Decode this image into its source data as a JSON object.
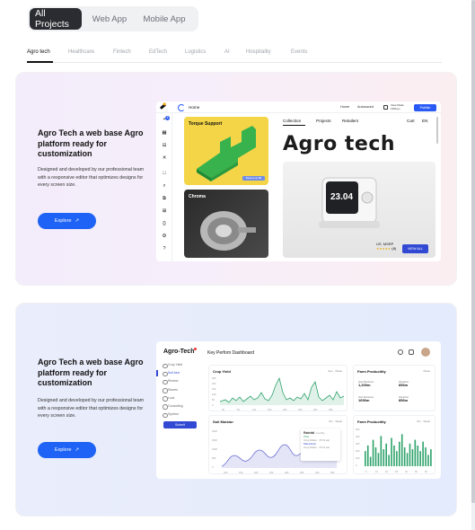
{
  "tabs": [
    "All Projects",
    "Web App",
    "Mobile App"
  ],
  "categories": [
    "Agro tech",
    "Healthcare",
    "Fintech",
    "EdTech",
    "Logistics",
    "AI",
    "Hospitality",
    "Events"
  ],
  "cards": [
    {
      "title": "Agro Tech a web base Agro platform ready for customization",
      "description": "Designed and developed by our professional team with a responsive editor that optimizes designs for every screen size.",
      "button": "Explore",
      "shot": {
        "topbar": {
          "home": "Home",
          "home_link": "Home",
          "autosaved": "Autosaved",
          "view_mode": "View Mode",
          "view_mode_size": "1366 px",
          "publish": "Publish"
        },
        "sidebar_badge": "8",
        "tile1": {
          "label": "Torque Support",
          "cta": "Reserve an RE"
        },
        "tile2": {
          "label": "Chroma"
        },
        "nav": [
          "Collection",
          "Projects",
          "Retailers",
          "Cart",
          "EN"
        ],
        "headline": "Agro tech",
        "device_time": "23.04",
        "msrp": "US. MSRP",
        "rating_count": "(8)",
        "view_all": "VIEW ALL"
      }
    },
    {
      "title": "Agro Tech a web base Agro platform ready for customization",
      "description": "Designed and developed by our professional team with a responsive editor that optimizes designs for every screen size.",
      "button": "Explore",
      "shot": {
        "brand": "Agro-Tech",
        "header_title": "Key Perfom Dashboard",
        "sidebar": [
          "Crop Yield",
          "Soil bea",
          "Review",
          "Stories",
          "Lock",
          "Consulting",
          "Symbol"
        ],
        "submit": "Submit",
        "crop_yield": "Crop Yield",
        "crop_ctrl": "Seo · Week",
        "crop_y_ticks": [
          "250",
          "200",
          "150",
          "100",
          "50",
          "0"
        ],
        "crop_x_ticks": [
          "30",
          "50",
          "110",
          "150",
          "200",
          "250",
          "300",
          "350"
        ],
        "farm_prod": "Farm Producitity",
        "farm_ctrl": "Week",
        "kpis": [
          {
            "label": "Soil Moisture",
            "value": "1,200m"
          },
          {
            "label": "Weather",
            "value": "856m"
          },
          {
            "label": "Soil Moisture",
            "value": "1690m"
          },
          {
            "label": "Weather",
            "value": "856m"
          }
        ],
        "soil_moisture": "Soil Moistur",
        "soil_ctrl": "Div · Week",
        "soil_y_ticks": [
          "2000",
          "1500",
          "1000",
          "500",
          "0"
        ],
        "soil_x_ticks": [
          "100",
          "150",
          "200",
          "250",
          "300",
          "350",
          "400",
          "450"
        ],
        "tip": {
          "title": "Rainfall",
          "tag": "monthly",
          "a": "PSA",
          "a_sub": "Crop Moist · 70 % car",
          "b": "Maturation",
          "b_sub": "Crop Moist · 70 % car"
        },
        "farm_prod2": "Farm Producitity",
        "farm_ctrl2": "Div · Week",
        "bar_y_ticks": [
          "500",
          "400",
          "300",
          "200",
          "100",
          "0"
        ],
        "bar_x_ticks": [
          "0",
          "10",
          "20",
          "30",
          "40",
          "50",
          "60"
        ],
        "bar_values": [
          40,
          55,
          25,
          70,
          50,
          35,
          80,
          45,
          60,
          30,
          75,
          55,
          40,
          65,
          85,
          50,
          35,
          60,
          45,
          70,
          55,
          40,
          65,
          50,
          30,
          45
        ]
      }
    }
  ],
  "colors": {
    "accent": "#1e63f5",
    "primary_dark": "#3249d3",
    "line_green": "#2ea36b",
    "line_purple": "#6b6fd4"
  }
}
